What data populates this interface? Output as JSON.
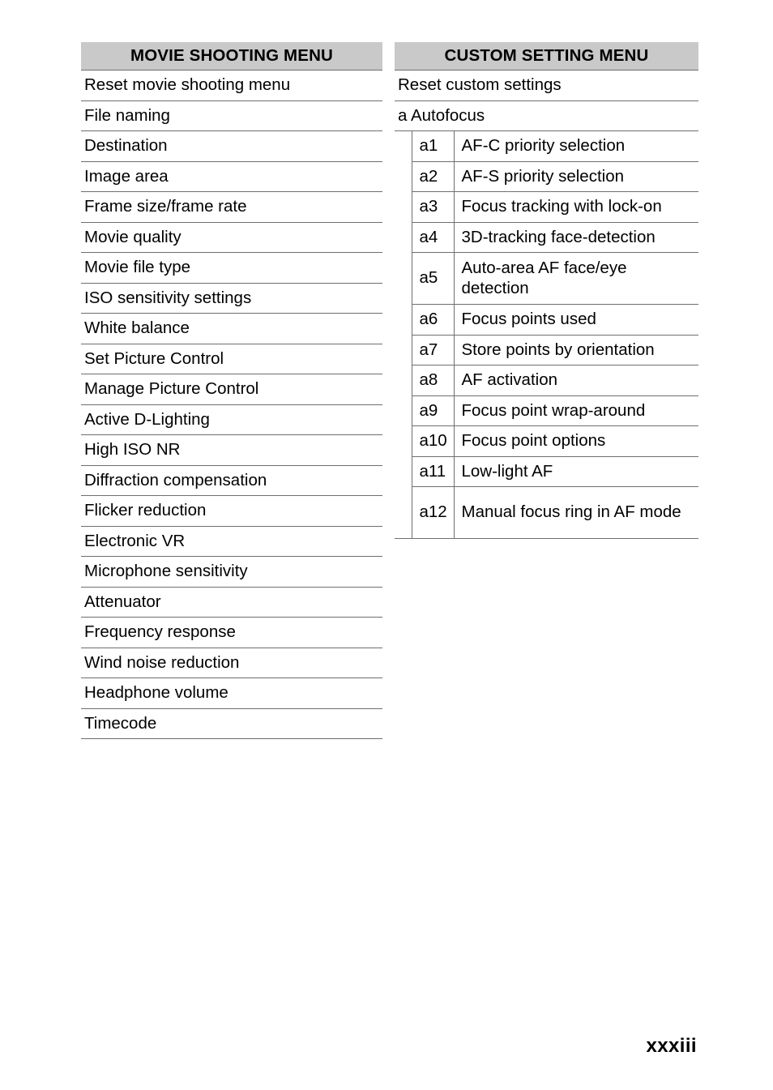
{
  "page": {
    "number": "xxxiii"
  },
  "movie_shooting_menu": {
    "title": "MOVIE SHOOTING MENU",
    "items": [
      "Reset movie shooting menu",
      "File naming",
      "Destination",
      "Image area",
      "Frame size/frame rate",
      "Movie quality",
      "Movie file type",
      "ISO sensitivity settings",
      "White balance",
      "Set Picture Control",
      "Manage Picture Control",
      "Active D-Lighting",
      "High ISO NR",
      "Diffraction compensation",
      "Flicker reduction",
      "Electronic VR",
      "Microphone sensitivity",
      "Attenuator",
      "Frequency response",
      "Wind noise reduction",
      "Headphone volume",
      "Timecode"
    ]
  },
  "custom_setting_menu": {
    "title": "CUSTOM SETTING MENU",
    "top_items": [
      "Reset custom settings",
      "a Autofocus"
    ],
    "sub_items": [
      {
        "code": "a1",
        "label": "AF-C priority selection"
      },
      {
        "code": "a2",
        "label": "AF-S priority selection"
      },
      {
        "code": "a3",
        "label": "Focus tracking with lock-on"
      },
      {
        "code": "a4",
        "label": "3D-tracking face-detection"
      },
      {
        "code": "a5",
        "label": "Auto-area AF face/eye detection"
      },
      {
        "code": "a6",
        "label": "Focus points used"
      },
      {
        "code": "a7",
        "label": "Store points by orientation"
      },
      {
        "code": "a8",
        "label": "AF activation"
      },
      {
        "code": "a9",
        "label": "Focus point wrap-around"
      },
      {
        "code": "a10",
        "label": "Focus point options"
      },
      {
        "code": "a11",
        "label": "Low-light AF"
      },
      {
        "code": "a12",
        "label": "Manual focus ring in AF mode"
      }
    ]
  }
}
